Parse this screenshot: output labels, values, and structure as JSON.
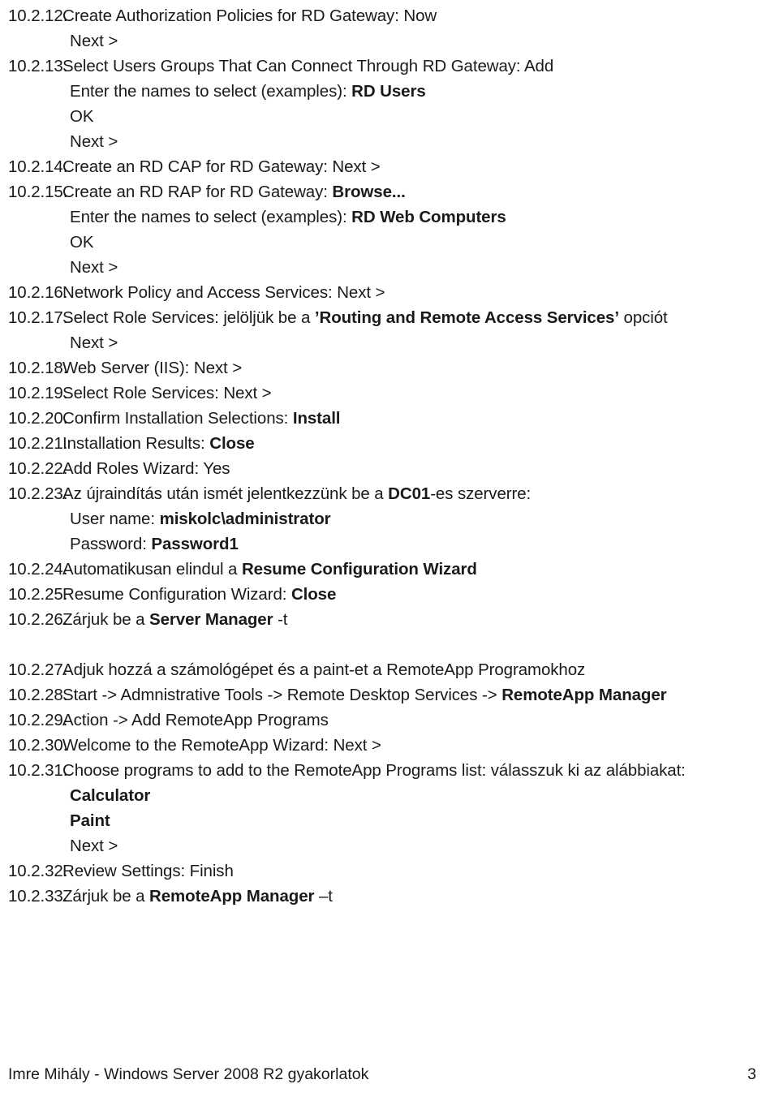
{
  "document": {
    "type": "numbered-procedure-list",
    "language": "hu",
    "footer": {
      "left_text": "Imre Mihály - Windows Server 2008 R2 gyakorlatok",
      "page_number": "3"
    }
  },
  "items": [
    {
      "number": "10.2.12.",
      "text_html": "Create Authorization Policies for RD Gateway: Now",
      "subs": [
        {
          "text_html": "Next >"
        }
      ]
    },
    {
      "number": "10.2.13.",
      "text_html": "Select Users Groups That Can Connect Through RD Gateway: Add",
      "subs": [
        {
          "text_html": "Enter the names to select (examples): <b>RD Users</b>"
        },
        {
          "text_html": "OK"
        },
        {
          "text_html": "Next >"
        }
      ]
    },
    {
      "number": "10.2.14.",
      "text_html": "Create an RD CAP for RD Gateway: Next >",
      "subs": []
    },
    {
      "number": "10.2.15.",
      "text_html": "Create an RD RAP for RD Gateway: <b>Browse...</b>",
      "subs": [
        {
          "text_html": "Enter the names to select (examples): <b>RD Web Computers</b>"
        },
        {
          "text_html": "OK"
        },
        {
          "text_html": "Next >"
        }
      ]
    },
    {
      "number": "10.2.16.",
      "text_html": "Network Policy and Access Services: Next >",
      "subs": []
    },
    {
      "number": "10.2.17.",
      "text_html": "Select Role Services: jelöljük be a <b>&rsquo;Routing and Remote Access Services&rsquo;</b> opciót",
      "subs": [
        {
          "text_html": "Next >"
        }
      ]
    },
    {
      "number": "10.2.18.",
      "text_html": "Web Server (IIS): Next >",
      "subs": []
    },
    {
      "number": "10.2.19.",
      "text_html": "Select Role Services: Next >",
      "subs": []
    },
    {
      "number": "10.2.20.",
      "text_html": "Confirm Installation Selections: <b>Install</b>",
      "subs": []
    },
    {
      "number": "10.2.21.",
      "text_html": "Installation Results: <b>Close</b>",
      "subs": []
    },
    {
      "number": "10.2.22.",
      "text_html": "Add Roles Wizard: Yes",
      "subs": []
    },
    {
      "number": "10.2.23.",
      "text_html": "Az újraindítás után ismét jelentkezzünk be a <b>DC01</b>-es szerverre:",
      "subs": [
        {
          "text_html": "User name: <b>miskolc\\administrator</b>"
        },
        {
          "text_html": "Password: <b>Password1</b>"
        }
      ]
    },
    {
      "number": "10.2.24.",
      "text_html": "Automatikusan elindul a <b>Resume Configuration Wizard</b>",
      "subs": []
    },
    {
      "number": "10.2.25.",
      "text_html": "Resume Configuration Wizard: <b>Close</b>",
      "subs": []
    },
    {
      "number": "10.2.26.",
      "text_html": "Zárjuk be a <b>Server Manager</b> -t",
      "subs": [],
      "gap_after": true
    },
    {
      "number": "10.2.27.",
      "text_html": "Adjuk hozzá a számológépet és a paint-et a RemoteApp Programokhoz",
      "subs": []
    },
    {
      "number": "10.2.28.",
      "text_html": "Start -&gt; Admnistrative Tools -&gt; Remote Desktop Services -&gt; <b>RemoteApp Manager</b>",
      "subs": []
    },
    {
      "number": "10.2.29.",
      "text_html": "Action -&gt; Add RemoteApp Programs",
      "subs": []
    },
    {
      "number": "10.2.30.",
      "text_html": "Welcome to the RemoteApp Wizard: Next >",
      "subs": []
    },
    {
      "number": "10.2.31.",
      "text_html": "Choose programs to add to the RemoteApp Programs list: válasszuk ki az alábbiakat:",
      "subs": [
        {
          "text_html": "<b>Calculator</b>"
        },
        {
          "text_html": "<b>Paint</b>"
        },
        {
          "text_html": "Next >"
        }
      ]
    },
    {
      "number": "10.2.32.",
      "text_html": "Review Settings: Finish",
      "subs": []
    },
    {
      "number": "10.2.33.",
      "text_html": "Zárjuk be a <b>RemoteApp Manager</b> &ndash;t",
      "subs": []
    }
  ]
}
